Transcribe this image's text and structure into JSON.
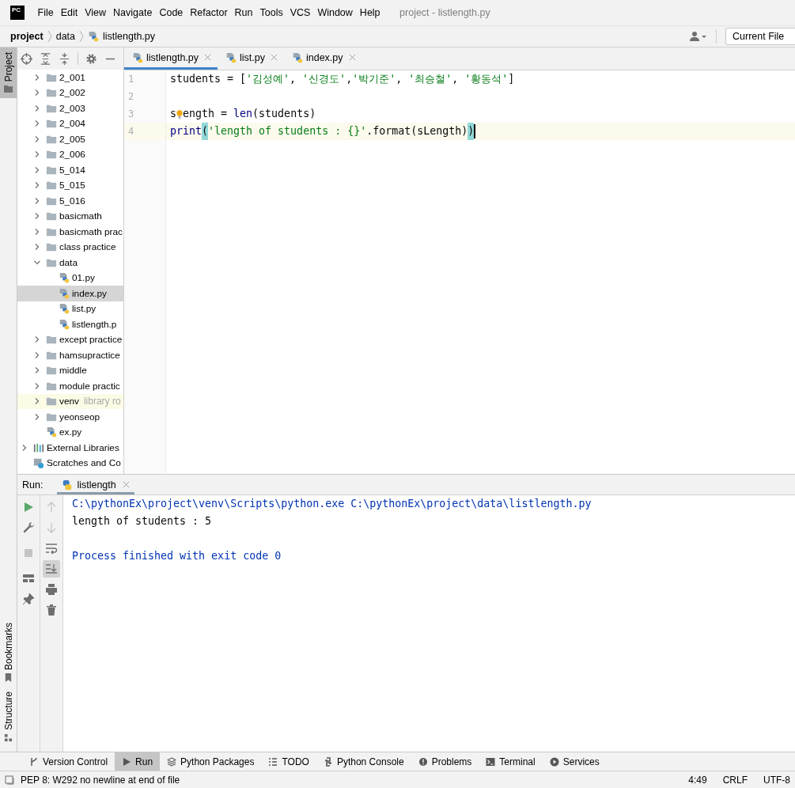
{
  "window": {
    "logo": "PC",
    "title": "project - listlength.py"
  },
  "menu": [
    "File",
    "Edit",
    "View",
    "Navigate",
    "Code",
    "Refactor",
    "Run",
    "Tools",
    "VCS",
    "Window",
    "Help"
  ],
  "breadcrumb": [
    {
      "label": "project",
      "kind": "project"
    },
    {
      "label": "data",
      "kind": "folder"
    },
    {
      "label": "listlength.py",
      "kind": "pyfile"
    }
  ],
  "run_config": "Current File",
  "side_tabs": [
    {
      "label": "Project",
      "kind": "project",
      "selected": true
    },
    {
      "label": "Bookmarks",
      "kind": "bookmarks",
      "selected": false
    },
    {
      "label": "Structure",
      "kind": "structure",
      "selected": false
    }
  ],
  "project_tree": [
    {
      "children": [
        {
          "label": "2_001",
          "kind": "folder",
          "expanded": false,
          "selected": false
        },
        {
          "label": "2_002",
          "kind": "folder",
          "expanded": false,
          "selected": false
        },
        {
          "label": "2_003",
          "kind": "folder",
          "expanded": false,
          "selected": false
        },
        {
          "label": "2_004",
          "kind": "folder",
          "expanded": false,
          "selected": false
        },
        {
          "label": "2_005",
          "kind": "folder",
          "expanded": false,
          "selected": false
        },
        {
          "label": "2_006",
          "kind": "folder",
          "expanded": false,
          "selected": false
        },
        {
          "label": "5_014",
          "kind": "folder",
          "expanded": false,
          "selected": false
        },
        {
          "label": "5_015",
          "kind": "folder",
          "expanded": false,
          "selected": false
        },
        {
          "label": "5_016",
          "kind": "folder",
          "expanded": false,
          "selected": false
        },
        {
          "label": "basicmath",
          "kind": "folder",
          "expanded": false,
          "selected": false
        },
        {
          "label": "basicmath prac",
          "kind": "folder",
          "expanded": false,
          "selected": false
        },
        {
          "label": "class practice",
          "kind": "folder",
          "expanded": false,
          "selected": false
        },
        {
          "label": "data",
          "kind": "folder",
          "expanded": true,
          "selected": false,
          "children": [
            {
              "label": "01.py",
              "kind": "pyfile",
              "selected": false
            },
            {
              "label": "index.py",
              "kind": "pyfile",
              "selected": true
            },
            {
              "label": "list.py",
              "kind": "pyfile",
              "selected": false
            },
            {
              "label": "listlength.p",
              "kind": "pyfile",
              "selected": false
            }
          ]
        },
        {
          "label": "except practice",
          "kind": "folder",
          "expanded": false,
          "selected": false
        },
        {
          "label": "hamsupractice",
          "kind": "folder",
          "expanded": false,
          "selected": false
        },
        {
          "label": "middle",
          "kind": "folder",
          "expanded": false,
          "selected": false
        },
        {
          "label": "module practic",
          "kind": "folder",
          "expanded": false,
          "selected": false
        },
        {
          "label": "venv",
          "hint": "library ro",
          "kind": "library_root",
          "expanded": false,
          "selected": false
        },
        {
          "label": "yeonseop",
          "kind": "folder",
          "expanded": false,
          "selected": false
        },
        {
          "label": "ex.py",
          "kind": "pyfile",
          "selected": false
        }
      ]
    },
    {
      "label": "External Libraries",
      "kind": "libraries",
      "expanded": false,
      "selected": false
    },
    {
      "label": "Scratches and Co",
      "kind": "scratches",
      "selected": false
    }
  ],
  "editor": {
    "tabs": [
      {
        "label": "listlength.py",
        "selected": true
      },
      {
        "label": "list.py",
        "selected": false
      },
      {
        "label": "index.py",
        "selected": false
      }
    ],
    "lines": [
      {
        "number": "1",
        "current": false,
        "tokens": [
          {
            "text": "students = [",
            "kind": "plain"
          },
          {
            "text": "'김성예'",
            "kind": "string"
          },
          {
            "text": ", ",
            "kind": "plain"
          },
          {
            "text": "'신경도'",
            "kind": "string"
          },
          {
            "text": ",",
            "kind": "plain"
          },
          {
            "text": "'박기준'",
            "kind": "string"
          },
          {
            "text": ", ",
            "kind": "plain"
          },
          {
            "text": "'최승철'",
            "kind": "string"
          },
          {
            "text": ", ",
            "kind": "plain"
          },
          {
            "text": "'황동석'",
            "kind": "string"
          },
          {
            "text": "]",
            "kind": "plain"
          }
        ]
      },
      {
        "number": "2",
        "current": false
      },
      {
        "number": "3",
        "current": false,
        "tokens": [
          {
            "text": "s",
            "kind": "plain"
          },
          {
            "kind": "bulb"
          },
          {
            "text": "ength = ",
            "kind": "plain"
          },
          {
            "text": "len",
            "kind": "builtin"
          },
          {
            "text": "(students)",
            "kind": "plain"
          }
        ]
      },
      {
        "number": "4",
        "current": true,
        "tokens": [
          {
            "text": "print",
            "kind": "builtin"
          },
          {
            "text": "(",
            "kind": "brace_match"
          },
          {
            "text": "'length of students : {}'",
            "kind": "string"
          },
          {
            "text": ".format(sLength)",
            "kind": "plain"
          },
          {
            "text": ")",
            "kind": "brace_match"
          },
          {
            "kind": "caret"
          }
        ]
      }
    ]
  },
  "run": {
    "label": "Run:",
    "tab": "listlength",
    "left_actions": [
      {
        "kind": "rerun",
        "disabled": false
      },
      {
        "kind": "settings",
        "disabled": false
      },
      {
        "kind": "stop",
        "disabled": true
      },
      {
        "kind": "layout",
        "disabled": false
      },
      {
        "kind": "pin",
        "disabled": false
      }
    ],
    "right_actions": [
      {
        "kind": "up",
        "disabled": true,
        "on": false
      },
      {
        "kind": "down",
        "disabled": true,
        "on": false
      },
      {
        "kind": "wrap",
        "disabled": false,
        "on": false
      },
      {
        "kind": "scroll_end",
        "disabled": false,
        "on": true
      },
      {
        "kind": "print",
        "disabled": false,
        "on": false
      },
      {
        "kind": "trash",
        "disabled": false,
        "on": false
      }
    ],
    "console": [
      {
        "text": "C:\\pythonEx\\project\\venv\\Scripts\\python.exe C:\\pythonEx\\project\\data\\listlength.py",
        "kind": "command"
      },
      {
        "text": "length of students : 5",
        "kind": "stdout"
      },
      {
        "text": "Process finished with exit code 0",
        "kind": "exit"
      }
    ]
  },
  "tool_windows": [
    {
      "label": "Version Control",
      "kind": "vcs",
      "selected": false
    },
    {
      "label": "Run",
      "kind": "run",
      "selected": true
    },
    {
      "label": "Python Packages",
      "kind": "packages",
      "selected": false
    },
    {
      "label": "TODO",
      "kind": "todo",
      "selected": false
    },
    {
      "label": "Python Console",
      "kind": "console",
      "selected": false
    },
    {
      "label": "Problems",
      "kind": "problems",
      "selected": false
    },
    {
      "label": "Terminal",
      "kind": "terminal",
      "selected": false
    },
    {
      "label": "Services",
      "kind": "services",
      "selected": false
    }
  ],
  "status": {
    "message": "PEP 8: W292 no newline at end of file",
    "position": "4:49",
    "line_separator": "CRLF",
    "encoding": "UTF-8"
  }
}
